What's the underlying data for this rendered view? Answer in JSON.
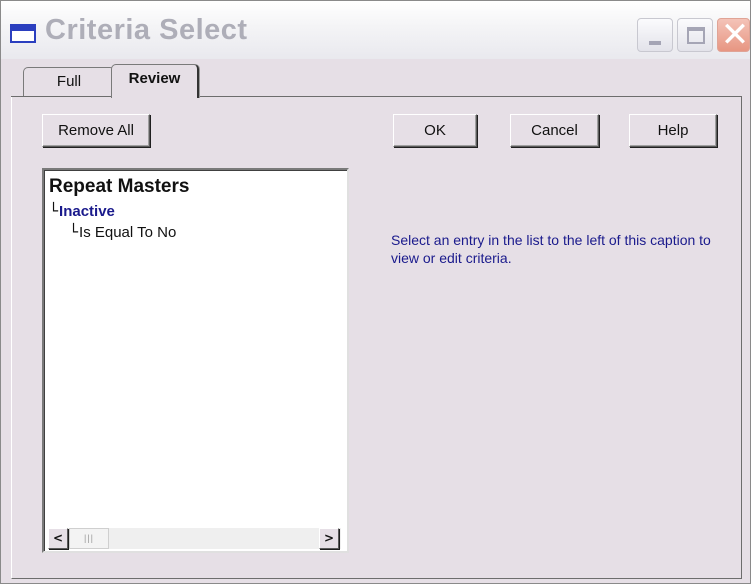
{
  "window": {
    "title": "Criteria Select",
    "controls": {
      "minimize": "minimize",
      "maximize": "maximize",
      "close": "✕"
    }
  },
  "tabs": [
    {
      "label": "Full",
      "selected": false
    },
    {
      "label": "Review",
      "selected": true
    }
  ],
  "buttons": {
    "remove_all": "Remove All",
    "ok": "OK",
    "cancel": "Cancel",
    "help": "Help"
  },
  "tree": {
    "root": "Repeat Masters",
    "field": "Inactive",
    "condition": "Is Equal To No"
  },
  "scrollbar": {
    "left_arrow": "<",
    "right_arrow": ">",
    "thumb_grip": "|||"
  },
  "caption": "Select an entry in the list to the left of this caption to view or edit criteria.",
  "colors": {
    "window_bg": "#e6dfe6",
    "caption_text": "#1a1a8c",
    "tree_field_text": "#1a1a8c",
    "title_text": "#aeaeb8"
  },
  "icons": {
    "title_icon": "window-icon",
    "minimize": "minimize-icon",
    "maximize": "maximize-icon",
    "close": "close-icon",
    "tree_elbow": "tree-elbow-icon"
  }
}
